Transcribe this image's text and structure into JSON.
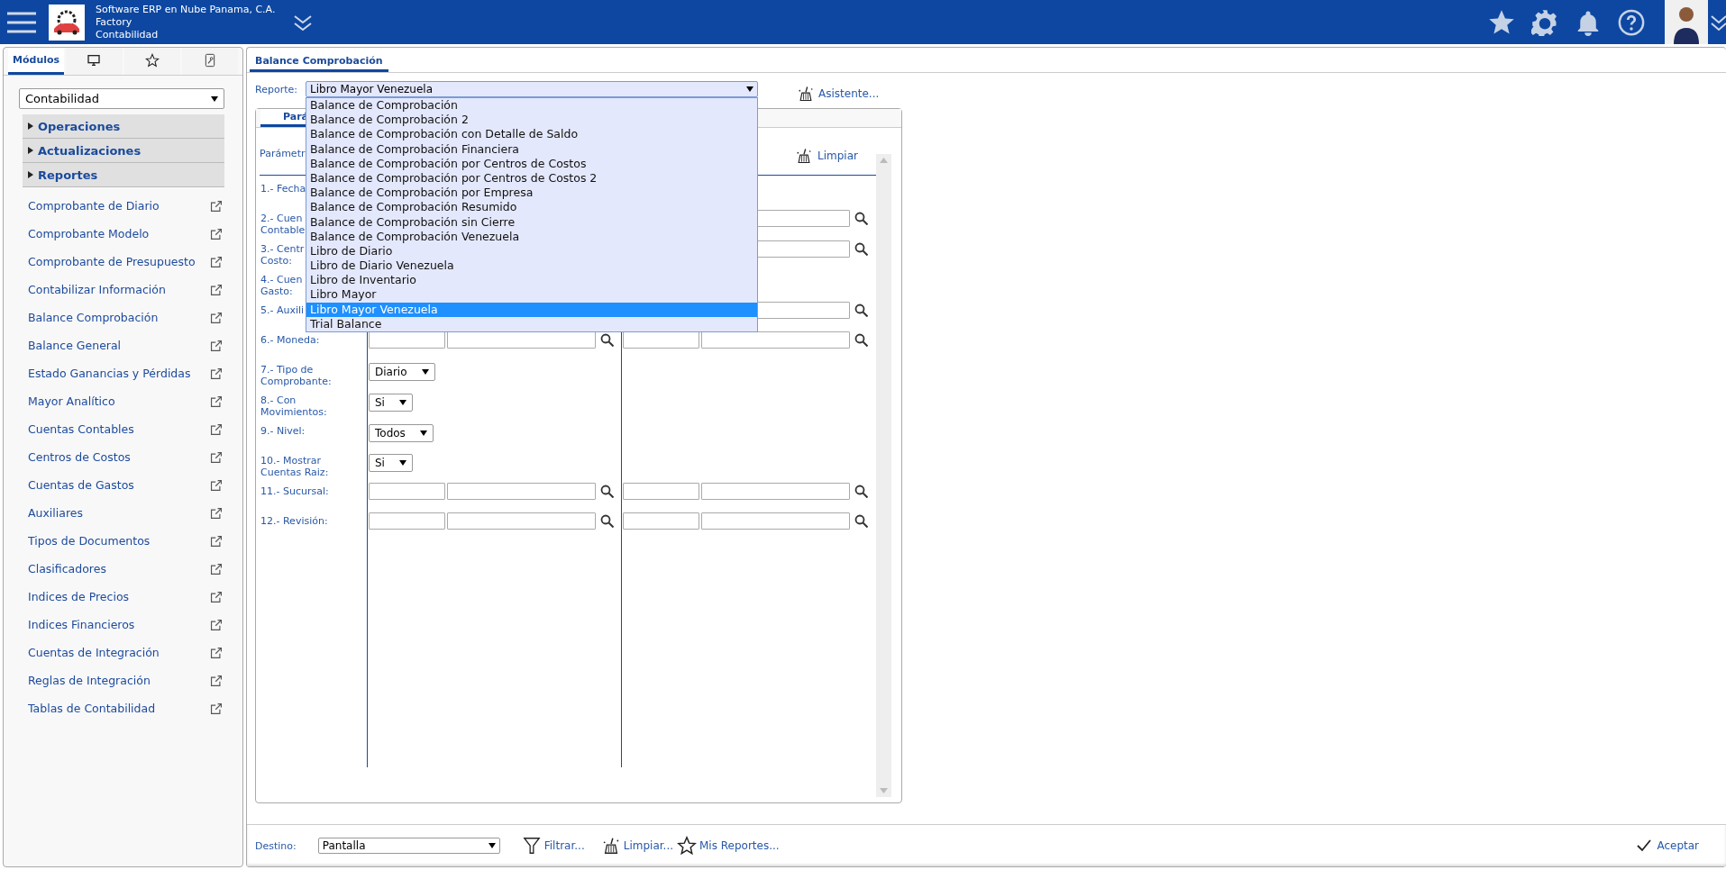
{
  "header": {
    "company": "Software ERP en Nube Panama, C.A.",
    "app": "Factory",
    "module": "Contabilidad"
  },
  "sidebar": {
    "tabs": [
      {
        "kind": "text",
        "label": "Módulos",
        "selected": true
      },
      {
        "kind": "monitor",
        "selected": false
      },
      {
        "kind": "star",
        "selected": false
      },
      {
        "kind": "tool",
        "selected": false
      }
    ],
    "module_select": {
      "value": "Contabilidad"
    },
    "sections": [
      {
        "label": "Operaciones",
        "expanded": false
      },
      {
        "label": "Actualizaciones",
        "expanded": false
      },
      {
        "label": "Reportes",
        "expanded": false
      }
    ],
    "items": [
      "Comprobante de Diario",
      "Comprobante Modelo",
      "Comprobante de Presupuesto",
      "Contabilizar Información",
      "Balance Comprobación",
      "Balance General",
      "Estado Ganancias y Pérdidas",
      "Mayor Analítico",
      "Cuentas Contables",
      "Centros de Costos",
      "Cuentas de Gastos",
      "Auxiliares",
      "Tipos de Documentos",
      "Clasificadores",
      "Indices de Precios",
      "Indices Financieros",
      "Cuentas de Integración",
      "Reglas de Integración",
      "Tablas de Contabilidad"
    ]
  },
  "main_tabs": [
    {
      "label": "Balance Comprobación",
      "selected": true
    }
  ],
  "report": {
    "label": "Reporte:",
    "value": "Libro Mayor Venezuela",
    "assistant": "Asistente...",
    "options": [
      {
        "label": "Balance de Comprobación",
        "selected": false
      },
      {
        "label": "Balance de Comprobación 2",
        "selected": false
      },
      {
        "label": "Balance de Comprobación con Detalle de Saldo",
        "selected": false
      },
      {
        "label": "Balance de Comprobación Financiera",
        "selected": false
      },
      {
        "label": "Balance de Comprobación por Centros de Costos",
        "selected": false
      },
      {
        "label": "Balance de Comprobación por Centros de Costos 2",
        "selected": false
      },
      {
        "label": "Balance de Comprobación por Empresa",
        "selected": false
      },
      {
        "label": "Balance de Comprobación Resumido",
        "selected": false
      },
      {
        "label": "Balance de Comprobación sin Cierre",
        "selected": false
      },
      {
        "label": "Balance de Comprobación Venezuela",
        "selected": false
      },
      {
        "label": "Libro de Diario",
        "selected": false
      },
      {
        "label": "Libro de Diario Venezuela",
        "selected": false
      },
      {
        "label": "Libro de Inventario",
        "selected": false
      },
      {
        "label": "Libro Mayor",
        "selected": false
      },
      {
        "label": "Libro Mayor Venezuela",
        "selected": true
      },
      {
        "label": "Trial Balance",
        "selected": false
      }
    ]
  },
  "parameters": {
    "tab": {
      "label": "Pará",
      "selected": true
    },
    "header": "Parámetr",
    "clear": "Limpiar",
    "rows": [
      {
        "lines": [
          "1.- Fecha"
        ],
        "kind": "covered"
      },
      {
        "lines": [
          "2.- Cuen",
          "Contable"
        ],
        "kind": "right_desc"
      },
      {
        "lines": [
          "3.- Centr",
          "Costo:"
        ],
        "kind": "right_desc"
      },
      {
        "lines": [
          "4.- Cuen",
          "Gasto:"
        ],
        "kind": "covered"
      },
      {
        "lines": [
          "5.- Auxili"
        ],
        "kind": "right_desc"
      },
      {
        "lines": [
          "6.- Moneda:"
        ],
        "kind": "range"
      },
      {
        "lines": [
          "7.- Tipo de",
          "Comprobante:"
        ],
        "kind": "select",
        "value": "Diario"
      },
      {
        "lines": [
          "8.- Con",
          "Movimientos:"
        ],
        "kind": "select",
        "value": "Si"
      },
      {
        "lines": [
          "9.- Nivel:"
        ],
        "kind": "select",
        "value": "Todos"
      },
      {
        "lines": [
          "10.- Mostrar",
          "Cuentas Raiz:"
        ],
        "kind": "select",
        "value": "Si"
      },
      {
        "lines": [
          "11.- Sucursal:"
        ],
        "kind": "range"
      },
      {
        "lines": [
          "12.- Revisión:"
        ],
        "kind": "range"
      }
    ]
  },
  "footer": {
    "destination": {
      "label": "Destino:",
      "value": "Pantalla"
    },
    "actions": [
      {
        "kind": "filter",
        "label": "Filtrar..."
      },
      {
        "kind": "broom",
        "label": "Limpiar..."
      },
      {
        "kind": "star",
        "label": "Mis Reportes..."
      }
    ],
    "accept": "Aceptar"
  }
}
